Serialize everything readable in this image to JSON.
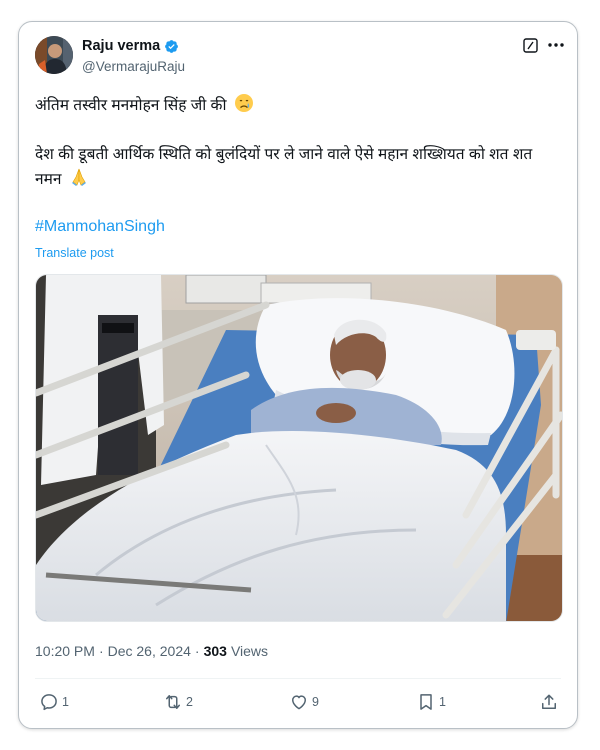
{
  "author": {
    "display_name": "Raju verma",
    "handle": "@VermarajuRaju",
    "avatar_icon": "profile-photo",
    "verified_color": "#1d9bf0"
  },
  "header_icons": [
    "grok-icon",
    "more-icon"
  ],
  "post": {
    "line1": "अंतिम तस्वीर मनमोहन सिंह जी की",
    "line1_emoji": "crying-face",
    "line2": "देश की डूबती आर्थिक स्थिति को बुलंदियों पर ले जाने वाले ऐसे महान शख्शियत को शत शत नमन",
    "line2_emoji": "folded-hands",
    "hashtag": "#ManmohanSingh",
    "translate_label": "Translate post",
    "image_alt": "hospital-bed-photo"
  },
  "meta": {
    "time": "10:20 PM",
    "separator": "·",
    "date": "Dec 26, 2024",
    "separator2": "·",
    "views_count": "303",
    "views_label": "Views"
  },
  "actions": {
    "replies": "1",
    "reposts": "2",
    "likes": "9",
    "bookmarks": "1"
  },
  "colors": {
    "accent": "#1d9bf0",
    "secondary_text": "#536471",
    "primary_text": "#0f1419"
  }
}
